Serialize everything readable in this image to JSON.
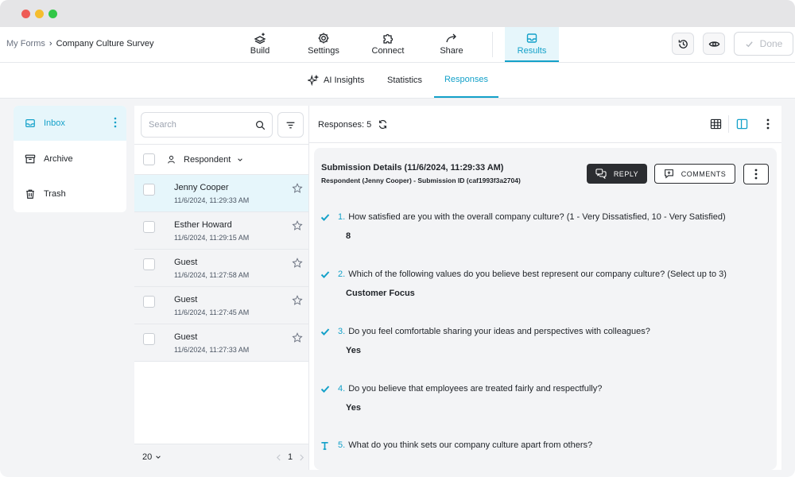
{
  "breadcrumb": {
    "root": "My Forms",
    "separator": "›",
    "current": "Company Culture Survey"
  },
  "topnav": {
    "items": [
      {
        "label": "Build",
        "icon": "build-icon"
      },
      {
        "label": "Settings",
        "icon": "gear-icon"
      },
      {
        "label": "Connect",
        "icon": "puzzle-icon"
      },
      {
        "label": "Share",
        "icon": "share-arrow-icon"
      },
      {
        "label": "Results",
        "icon": "inbox-icon",
        "active": true
      }
    ],
    "done_label": "Done"
  },
  "subnav": {
    "tabs": [
      {
        "label": "AI Insights",
        "icon": "sparkle-icon"
      },
      {
        "label": "Statistics"
      },
      {
        "label": "Responses",
        "active": true
      }
    ]
  },
  "sidebar": {
    "items": [
      {
        "label": "Inbox",
        "icon": "inbox-icon",
        "active": true
      },
      {
        "label": "Archive",
        "icon": "archive-icon"
      },
      {
        "label": "Trash",
        "icon": "trash-icon"
      }
    ]
  },
  "list": {
    "search_placeholder": "Search",
    "header_label": "Respondent",
    "rows": [
      {
        "name": "Jenny Cooper",
        "date": "11/6/2024, 11:29:33 AM",
        "selected": true
      },
      {
        "name": "Esther Howard",
        "date": "11/6/2024, 11:29:15 AM"
      },
      {
        "name": "Guest",
        "date": "11/6/2024, 11:27:58 AM"
      },
      {
        "name": "Guest",
        "date": "11/6/2024, 11:27:45 AM"
      },
      {
        "name": "Guest",
        "date": "11/6/2024, 11:27:33 AM"
      }
    ],
    "page_size": "20",
    "page": "1"
  },
  "detail": {
    "responses_label": "Responses: 5",
    "submission_title": "Submission Details (11/6/2024, 11:29:33 AM)",
    "submission_sub": "Respondent (Jenny Cooper) - Submission ID (caf1993f3a2704)",
    "reply_label": "REPLY",
    "comments_label": "COMMENTS",
    "questions": [
      {
        "num": "1.",
        "text": "How satisfied are you with the overall company culture? (1 - Very Dissatisfied, 10 - Very Satisfied)",
        "answer": "8",
        "icon": "check-icon"
      },
      {
        "num": "2.",
        "text": "Which of the following values do you believe best represent our company culture? (Select up to 3)",
        "answer": "Customer Focus",
        "icon": "check-icon"
      },
      {
        "num": "3.",
        "text": "Do you feel comfortable sharing your ideas and perspectives with colleagues?",
        "answer": "Yes",
        "icon": "check-icon"
      },
      {
        "num": "4.",
        "text": "Do you believe that employees are treated fairly and respectfully?",
        "answer": "Yes",
        "icon": "check-icon"
      },
      {
        "num": "5.",
        "text": "What do you think sets our company culture apart from others?",
        "answer": "",
        "icon": "text-type-icon"
      }
    ]
  },
  "colors": {
    "accent": "#14a1c9",
    "accent_bg": "#e6f6fb",
    "dark_button": "#2b2d31"
  }
}
